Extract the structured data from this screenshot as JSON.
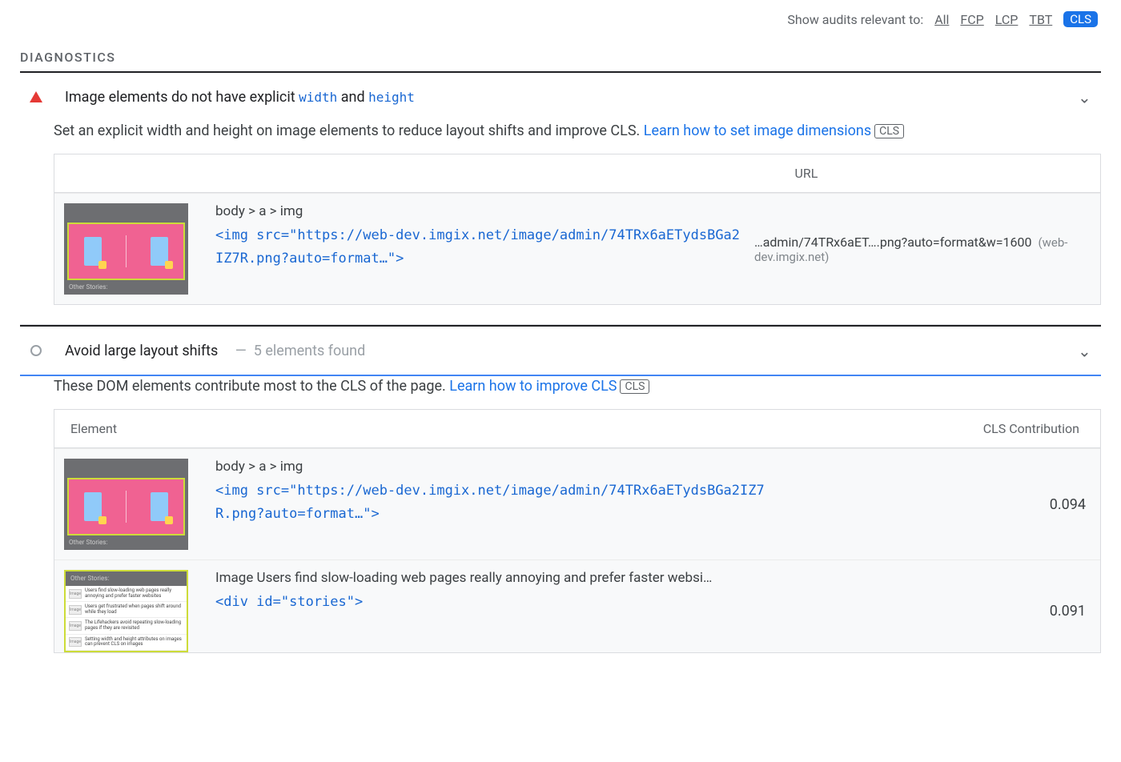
{
  "filter": {
    "label": "Show audits relevant to:",
    "all": "All",
    "fcp": "FCP",
    "lcp": "LCP",
    "tbt": "TBT",
    "cls": "CLS"
  },
  "section_heading": "DIAGNOSTICS",
  "audit1": {
    "title_pre": "Image elements do not have explicit ",
    "code1": "width",
    "mid": " and ",
    "code2": "height",
    "description": "Set an explicit width and height on image elements to reduce layout shifts and improve CLS. ",
    "learn": "Learn how to set image dimensions",
    "badge": "CLS",
    "table": {
      "header_url": "URL",
      "row": {
        "selector": "body > a > img",
        "code": "<img src=\"https://web-dev.imgix.net/image/admin/74TRx6aETydsBGa2IZ7R.png?auto=format…\">",
        "url": "…admin/74TRx6aET….png?auto=format&w=1600",
        "domain": "(web-dev.imgix.net)"
      }
    }
  },
  "audit2": {
    "title": "Avoid large layout shifts",
    "dash": "—",
    "subcount": "5 elements found",
    "description": "These DOM elements contribute most to the CLS of the page. ",
    "learn": "Learn how to improve CLS",
    "badge": "CLS",
    "table": {
      "header_element": "Element",
      "header_cls": "CLS Contribution",
      "rows": [
        {
          "selector": "body > a > img",
          "code": "<img src=\"https://web-dev.imgix.net/image/admin/74TRx6aETydsBGa2IZ7R.png?auto=format…\">",
          "cls": "0.094"
        },
        {
          "selector": "Image Users find slow-loading web pages really annoying and prefer faster websi…",
          "code": "<div id=\"stories\">",
          "cls": "0.091"
        }
      ]
    }
  },
  "thumb": {
    "caption": "Other Stories:",
    "list": [
      "Users find slow-loading web pages really annoying and prefer faster websites",
      "Users get frustrated when pages shift around while they load",
      "The Lifehackers avoid repeating slow-loading pages if they are revisited",
      "Setting width and height attributes on images can prevent CLS on images"
    ],
    "imgph": "Image"
  }
}
